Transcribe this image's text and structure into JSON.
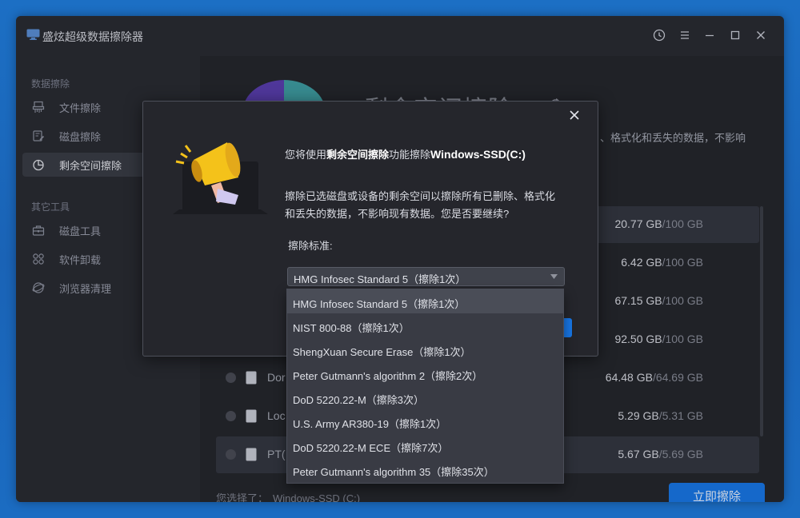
{
  "app": {
    "title": "盛炫超级数据擦除器"
  },
  "sidebar": {
    "group1": "数据擦除",
    "items": [
      {
        "label": "文件擦除",
        "icon": "shredder-icon"
      },
      {
        "label": "磁盘擦除",
        "icon": "disk-erase-icon"
      },
      {
        "label": "剩余空间擦除",
        "icon": "pie-chart-icon"
      }
    ],
    "group2": "其它工具",
    "tools": [
      {
        "label": "磁盘工具",
        "icon": "toolbox-icon"
      },
      {
        "label": "软件卸载",
        "icon": "apps-icon"
      },
      {
        "label": "浏览器清理",
        "icon": "browser-icon"
      }
    ]
  },
  "main": {
    "title": "剩余空间擦除",
    "desc_tail": "、格式化和丢失的数据，不影响"
  },
  "disks": [
    {
      "name": "",
      "used": "20.77 GB",
      "total": "/100 GB"
    },
    {
      "name": "",
      "used": "6.42 GB",
      "total": "/100 GB"
    },
    {
      "name": "",
      "used": "67.15 GB",
      "total": "/100 GB"
    },
    {
      "name": "",
      "used": "92.50 GB",
      "total": "/100 GB"
    },
    {
      "name": "Dor",
      "used": "64.48 GB",
      "total": "/64.69 GB"
    },
    {
      "name": "Loc",
      "used": "5.29 GB",
      "total": "/5.31 GB"
    },
    {
      "name": "PT(",
      "used": "5.67 GB",
      "total": "/5.69 GB"
    }
  ],
  "footer": {
    "selected_label": "您选择了：",
    "selected_value": "Windows-SSD (C:)",
    "erase_button": "立即擦除"
  },
  "dialog": {
    "line1_prefix": "您将使用",
    "line1_feature": "剩余空间擦除",
    "line1_mid": "功能擦除",
    "line1_target": "Windows-SSD(C:)",
    "message": "擦除已选磁盘或设备的剩余空间以擦除所有已删除、格式化和丢失的数据，不影响现有数据。您是否要继续?",
    "standard_label": "擦除标准:",
    "selected_standard": "HMG Infosec Standard 5（擦除1次）"
  },
  "dropdown_options": [
    "HMG Infosec Standard 5（擦除1次）",
    "NIST 800-88（擦除1次）",
    "ShengXuan Secure Erase（擦除1次）",
    "Peter Gutmann's algorithm 2（擦除2次）",
    "DoD 5220.22-M（擦除3次）",
    "U.S. Army AR380-19（擦除1次）",
    "DoD 5220.22-M ECE（擦除7次）",
    "Peter Gutmann's algorithm 35（擦除35次）"
  ],
  "colors": {
    "accent": "#1877e6",
    "megaphone": "#f4c21a",
    "window_bg": "#2a2c33"
  }
}
